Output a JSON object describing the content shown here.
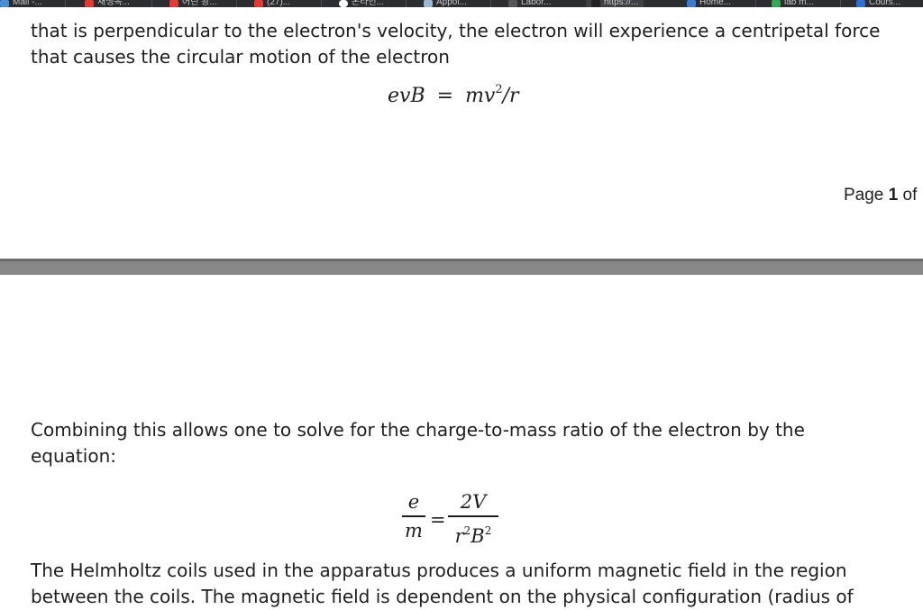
{
  "bookmarks": [
    {
      "label": "Mail -...",
      "icon": "mail-icon"
    },
    {
      "label": "재생목...",
      "icon": "youtube-icon"
    },
    {
      "label": "어린 왕...",
      "icon": "youtube-icon"
    },
    {
      "label": "(27)...",
      "icon": "youtube-icon"
    },
    {
      "label": "온라인...",
      "icon": "circle-icon"
    },
    {
      "label": "Appoi...",
      "icon": "sparkle-icon"
    },
    {
      "label": "Labor...",
      "icon": "blackboard-icon"
    },
    {
      "label": "https://...",
      "icon": "blackboard-icon"
    },
    {
      "label": "Home...",
      "icon": "home-icon"
    },
    {
      "label": "lab m...",
      "icon": "plus-icon"
    },
    {
      "label": "Cours...",
      "icon": "shield-icon"
    }
  ],
  "document": {
    "para1_line1": "that is perpendicular to the electron's velocity, the electron will experience a centripetal force",
    "para1_line2": "that causes the circular motion of the electron",
    "eq1": {
      "lhs": "evB",
      "equals": "=",
      "rhs_base": "mv",
      "rhs_exp": "2",
      "rhs_tail": "/r"
    },
    "page_indicator": {
      "prefix": "Page ",
      "current": "1",
      "suffix": " of"
    },
    "para2": "Combining this allows one to solve for the charge-to-mass ratio of the electron by the equation:",
    "eq2": {
      "lhs_num": "e",
      "lhs_den": "m",
      "equals": "=",
      "rhs_num": "2V",
      "rhs_den_r": "r",
      "rhs_den_B": "B",
      "exp": "2"
    },
    "para3_line1": "The Helmholtz coils used in the apparatus produces a uniform magnetic field in the region",
    "para3_line2": "between the coils. The magnetic field is dependent on the physical configuration (radius of"
  }
}
